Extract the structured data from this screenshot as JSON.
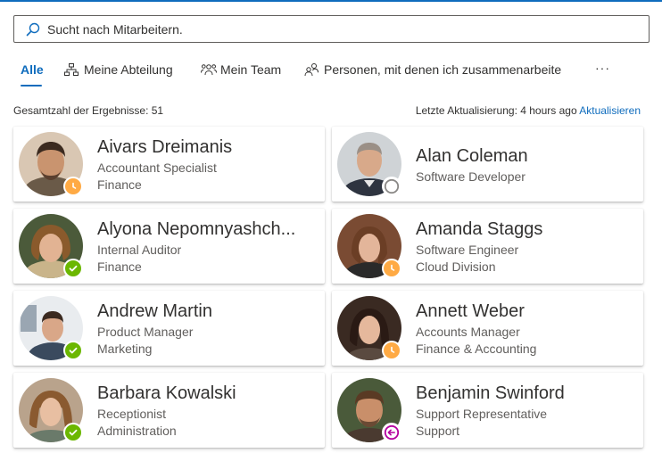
{
  "search": {
    "placeholder": "Sucht nach Mitarbeitern."
  },
  "tabs": [
    {
      "label": "Alle",
      "icon": "none",
      "active": true
    },
    {
      "label": "Meine Abteilung",
      "icon": "org-chart-icon"
    },
    {
      "label": "Mein Team",
      "icon": "people-team-icon"
    },
    {
      "label": "Personen, mit denen ich zusammenarbeite",
      "icon": "people-icon"
    }
  ],
  "more_label": "···",
  "summary": {
    "total_label": "Gesamtzahl der Ergebnisse: 51"
  },
  "updated": {
    "label": "Letzte Aktualisierung: 4 hours ago",
    "refresh_label": "Aktualisieren"
  },
  "colors": {
    "accent": "#0f6cbd",
    "available": "#6bb700",
    "away": "#ffaa44",
    "offline": "#8a8886",
    "out_of_office": "#b4009e"
  },
  "people": [
    {
      "name": "Aivars Dreimanis",
      "title": "Accountant Specialist",
      "department": "Finance",
      "presence": "away"
    },
    {
      "name": "Alan Coleman",
      "title": "Software Developer",
      "department": "",
      "presence": "offline"
    },
    {
      "name": "Alyona Nepomnyashch...",
      "title": "Internal Auditor",
      "department": "Finance",
      "presence": "available"
    },
    {
      "name": "Amanda Staggs",
      "title": "Software Engineer",
      "department": "Cloud Division",
      "presence": "away"
    },
    {
      "name": "Andrew Martin",
      "title": "Product Manager",
      "department": "Marketing",
      "presence": "available"
    },
    {
      "name": "Annett Weber",
      "title": "Accounts Manager",
      "department": "Finance & Accounting",
      "presence": "away"
    },
    {
      "name": "Barbara Kowalski",
      "title": "Receptionist",
      "department": "Administration",
      "presence": "available"
    },
    {
      "name": "Benjamin Swinford",
      "title": "Support Representative",
      "department": "Support",
      "presence": "out-of-office"
    }
  ]
}
